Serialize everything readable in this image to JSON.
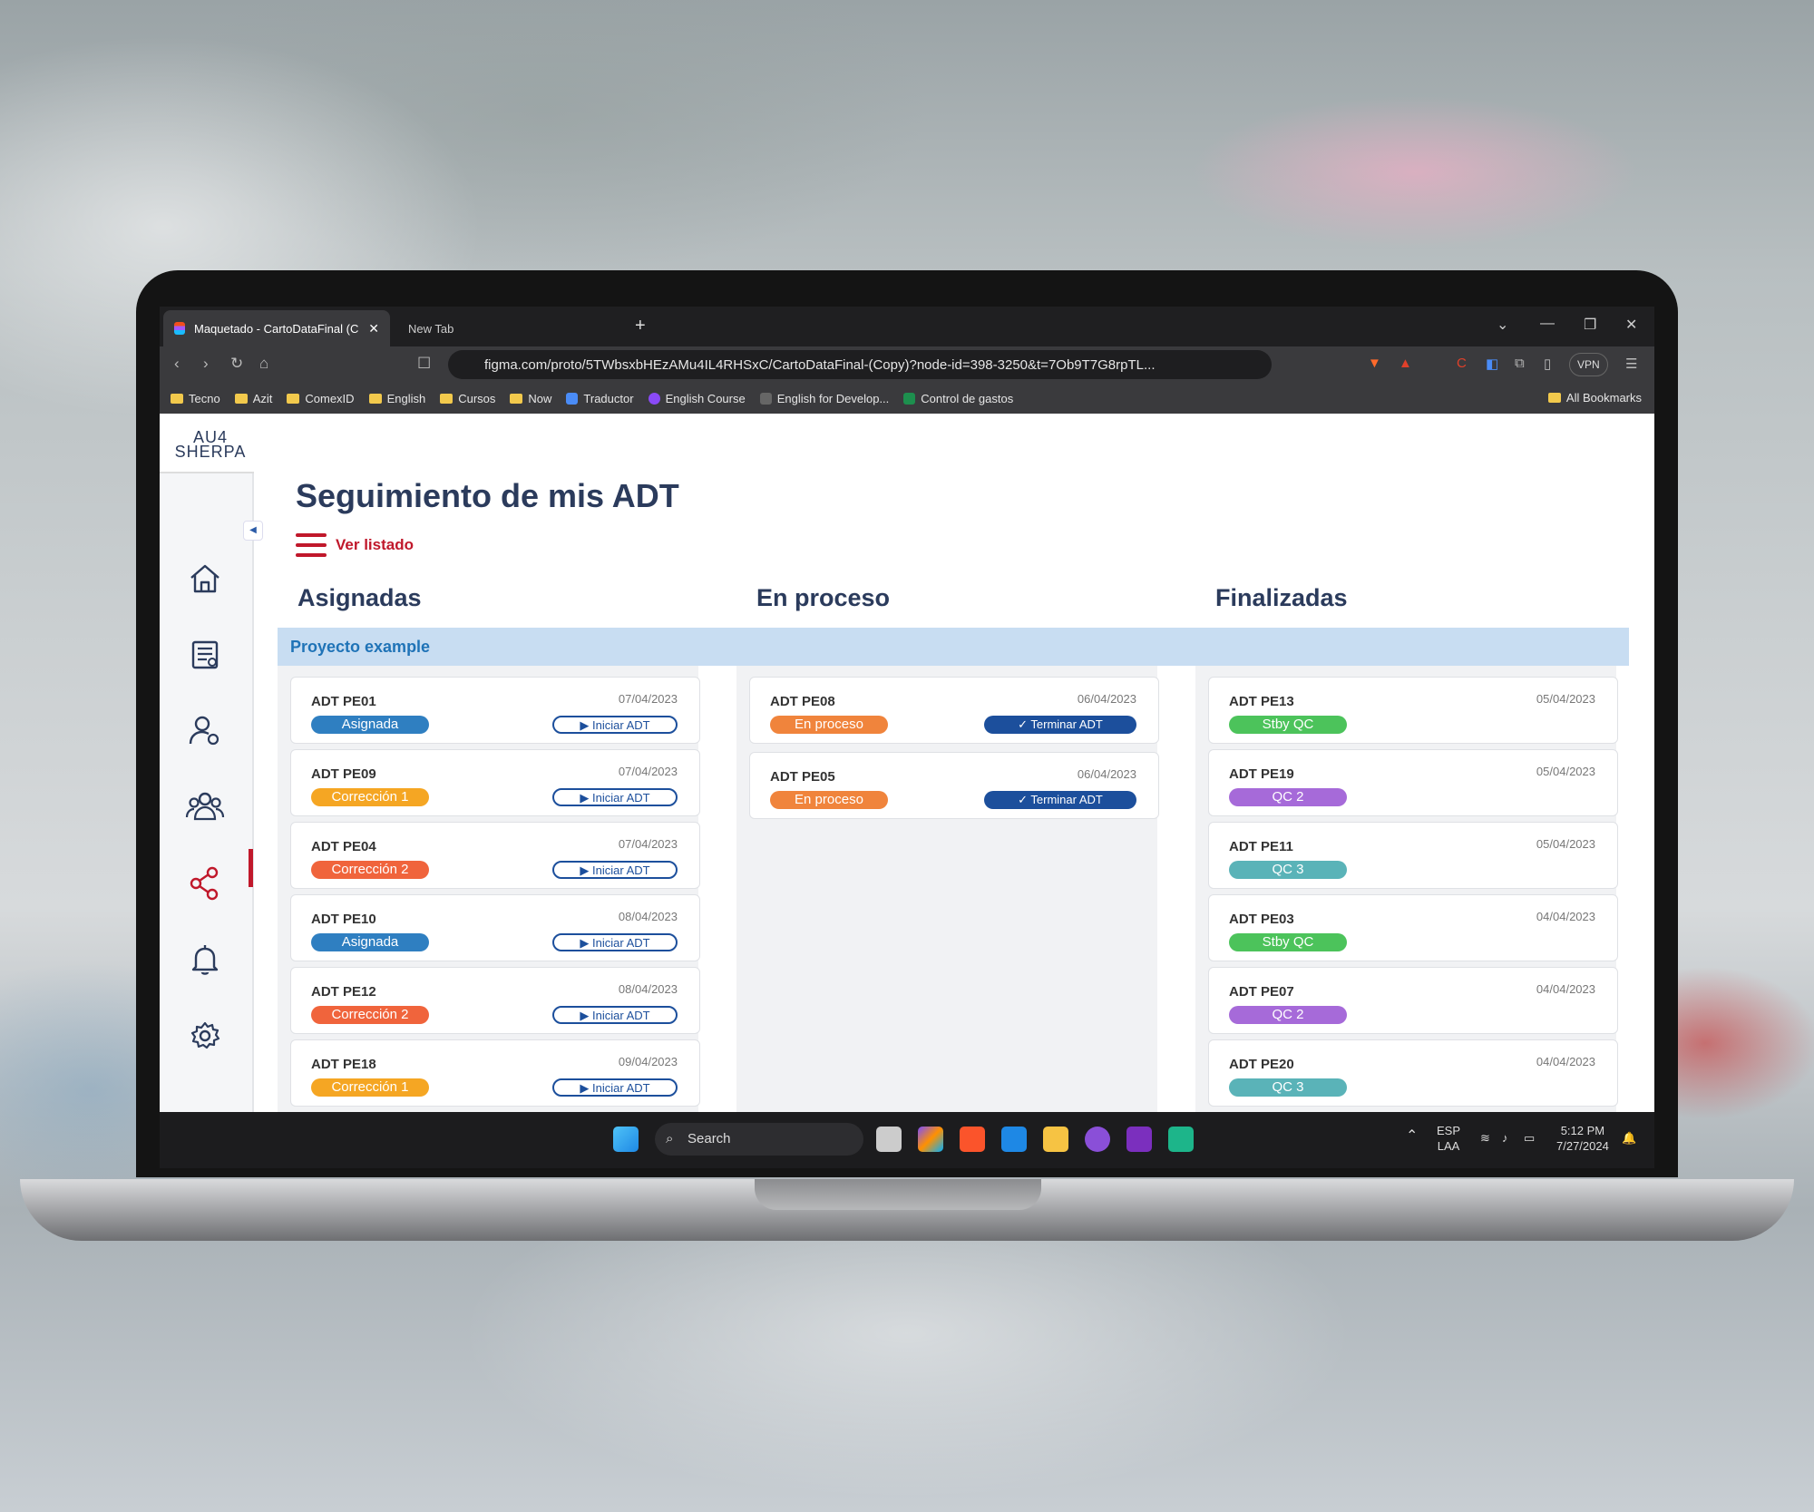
{
  "browser": {
    "active_tab": "Maquetado - CartoDataFinal (C",
    "new_tab": "New Tab",
    "url": "figma.com/proto/5TWbsxbHEzAMu4IL4RHSxC/CartoDataFinal-(Copy)?node-id=398-3250&t=7Ob9T7G8rpTL...",
    "vpn": "VPN",
    "bookmarks": [
      "Tecno",
      "Azit",
      "ComexID",
      "English",
      "Cursos",
      "Now",
      "Traductor",
      "English Course",
      "English for Develop...",
      "Control de gastos"
    ],
    "all_bookmarks": "All Bookmarks"
  },
  "app": {
    "logo_line1": "AU4",
    "logo_line2": "SHERPA",
    "title": "Seguimiento de mis ADT",
    "ver_listado": "Ver listado",
    "columns": {
      "assigned": "Asignadas",
      "in_progress": "En proceso",
      "finished": "Finalizadas"
    },
    "project": "Proyecto example",
    "colors": {
      "asignada": "#2f7fc1",
      "correccion1": "#f5a623",
      "correccion2": "#f0643c",
      "en_proceso": "#f0843c",
      "stby_qc": "#4cc35b",
      "qc2": "#a66ad9",
      "qc3": "#5ab3b8",
      "primary": "#1c4f9c",
      "accent": "#c0182b"
    },
    "asignadas": [
      {
        "name": "ADT PE01",
        "date": "07/04/2023",
        "status": "Asignada",
        "action": "Iniciar ADT"
      },
      {
        "name": "ADT PE09",
        "date": "07/04/2023",
        "status": "Corrección 1",
        "action": "Iniciar ADT"
      },
      {
        "name": "ADT PE04",
        "date": "07/04/2023",
        "status": "Corrección 2",
        "action": "Iniciar ADT"
      },
      {
        "name": "ADT PE10",
        "date": "08/04/2023",
        "status": "Asignada",
        "action": "Iniciar ADT"
      },
      {
        "name": "ADT PE12",
        "date": "08/04/2023",
        "status": "Corrección 2",
        "action": "Iniciar ADT"
      },
      {
        "name": "ADT PE18",
        "date": "09/04/2023",
        "status": "Corrección 1",
        "action": "Iniciar ADT"
      }
    ],
    "en_proceso": [
      {
        "name": "ADT PE08",
        "date": "06/04/2023",
        "status": "En proceso",
        "action": "Terminar ADT"
      },
      {
        "name": "ADT PE05",
        "date": "06/04/2023",
        "status": "En proceso",
        "action": "Terminar ADT"
      }
    ],
    "finalizadas": [
      {
        "name": "ADT PE13",
        "date": "05/04/2023",
        "status": "Stby QC"
      },
      {
        "name": "ADT PE19",
        "date": "05/04/2023",
        "status": "QC 2"
      },
      {
        "name": "ADT PE11",
        "date": "05/04/2023",
        "status": "QC 3"
      },
      {
        "name": "ADT PE03",
        "date": "04/04/2023",
        "status": "Stby QC"
      },
      {
        "name": "ADT PE07",
        "date": "04/04/2023",
        "status": "QC 2"
      },
      {
        "name": "ADT PE20",
        "date": "04/04/2023",
        "status": "QC 3"
      }
    ]
  },
  "taskbar": {
    "search": "Search",
    "lang1": "ESP",
    "lang2": "LAA",
    "time": "5:12 PM",
    "date": "7/27/2024"
  }
}
